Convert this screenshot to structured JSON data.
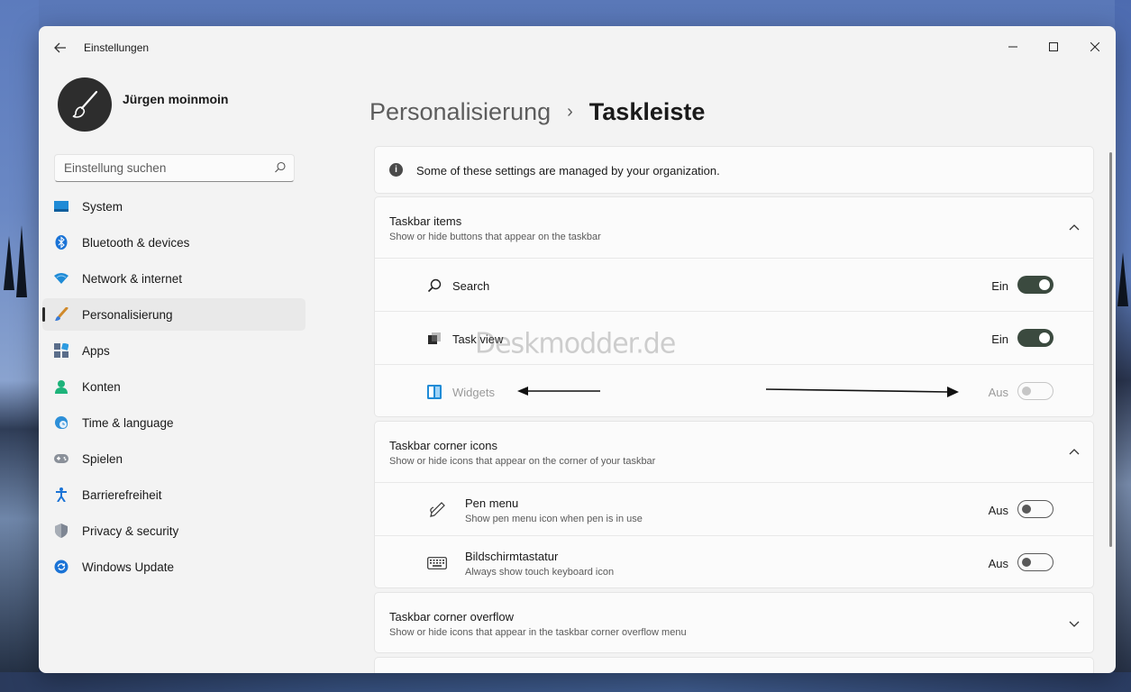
{
  "window": {
    "app_title": "Einstellungen",
    "controls": {
      "minimize": "—",
      "maximize": "☐",
      "close": "✕"
    }
  },
  "user": {
    "name": "Jürgen moinmoin"
  },
  "search": {
    "placeholder": "Einstellung suchen"
  },
  "sidebar": {
    "items": [
      {
        "label": "System",
        "icon": "system-icon",
        "active": false
      },
      {
        "label": "Bluetooth & devices",
        "icon": "bluetooth-icon",
        "active": false
      },
      {
        "label": "Network & internet",
        "icon": "wifi-icon",
        "active": false
      },
      {
        "label": "Personalisierung",
        "icon": "brush-icon",
        "active": true
      },
      {
        "label": "Apps",
        "icon": "apps-icon",
        "active": false
      },
      {
        "label": "Konten",
        "icon": "account-icon",
        "active": false
      },
      {
        "label": "Time & language",
        "icon": "globe-clock-icon",
        "active": false
      },
      {
        "label": "Spielen",
        "icon": "gamepad-icon",
        "active": false
      },
      {
        "label": "Barrierefreiheit",
        "icon": "accessibility-icon",
        "active": false
      },
      {
        "label": "Privacy & security",
        "icon": "shield-icon",
        "active": false
      },
      {
        "label": "Windows Update",
        "icon": "update-icon",
        "active": false
      }
    ]
  },
  "breadcrumb": {
    "parent": "Personalisierung",
    "separator": "›",
    "current": "Taskleiste"
  },
  "info": {
    "text": "Some of these settings are managed by your organization."
  },
  "taskbar_items": {
    "title": "Taskbar items",
    "subtitle": "Show or hide buttons that appear on the taskbar",
    "rows": [
      {
        "label": "Search",
        "state": "Ein",
        "icon": "search-icon",
        "on": true,
        "disabled": false
      },
      {
        "label": "Task view",
        "state": "Ein",
        "icon": "task-view-icon",
        "on": true,
        "disabled": false
      },
      {
        "label": "Widgets",
        "state": "Aus",
        "icon": "widgets-icon",
        "on": false,
        "disabled": true
      }
    ]
  },
  "corner_icons": {
    "title": "Taskbar corner icons",
    "subtitle": "Show or hide icons that appear on the corner of your taskbar",
    "rows": [
      {
        "title": "Pen menu",
        "desc": "Show pen menu icon when pen is in use",
        "state": "Aus",
        "icon": "pen-icon",
        "on": false
      },
      {
        "title": "Bildschirmtastatur",
        "desc": "Always show touch keyboard icon",
        "state": "Aus",
        "icon": "keyboard-icon",
        "on": false
      }
    ]
  },
  "corner_overflow": {
    "title": "Taskbar corner overflow",
    "subtitle": "Show or hide icons that appear in the taskbar corner overflow menu"
  },
  "watermark": {
    "text": "Deskmodder.de"
  },
  "colors": {
    "accent_toggle": "#3b4a3f",
    "window_bg": "#f3f3f3",
    "card_bg": "#fbfbfb"
  }
}
